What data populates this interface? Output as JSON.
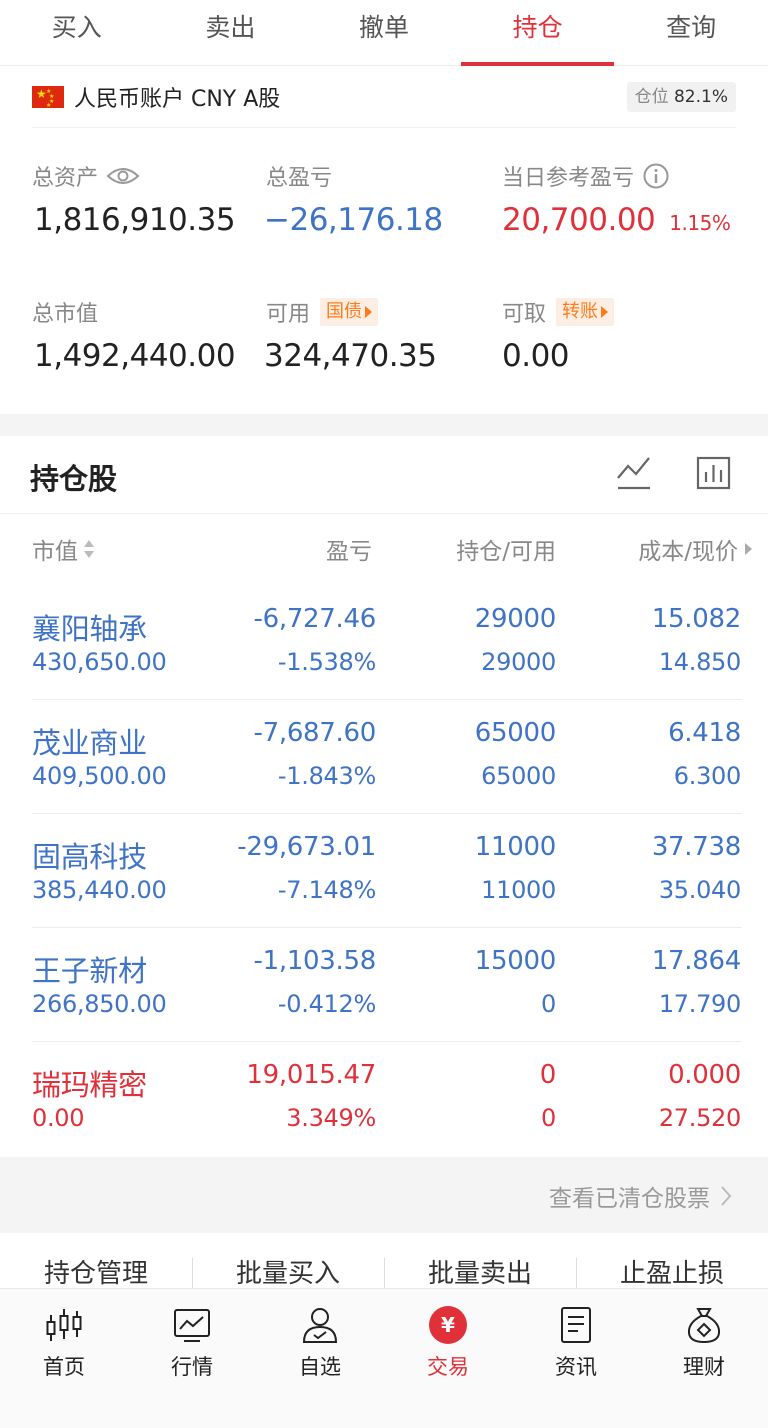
{
  "tabs": [
    "买入",
    "卖出",
    "撤单",
    "持仓",
    "查询"
  ],
  "account": {
    "name": "人民币账户 CNY A股",
    "position_label": "仓位",
    "position_value": "82.1%"
  },
  "summary": {
    "total_assets_label": "总资产",
    "total_assets": "1,816,910.35",
    "total_pnl_label": "总盈亏",
    "total_pnl": "−26,176.18",
    "daily_pnl_label": "当日参考盈亏",
    "daily_pnl": "20,700.00",
    "daily_pnl_pct": "1.15%",
    "market_value_label": "总市值",
    "market_value": "1,492,440.00",
    "available_label": "可用",
    "available_tag": "国债",
    "available": "324,470.35",
    "withdrawable_label": "可取",
    "withdrawable_tag": "转账",
    "withdrawable": "0.00"
  },
  "holdings": {
    "title": "持仓股",
    "headers": {
      "market_value": "市值",
      "pnl": "盈亏",
      "position": "持仓/可用",
      "price": "成本/现价"
    },
    "rows": [
      {
        "name": "襄阳轴承",
        "value": "430,650.00",
        "pnl": "-6,727.46",
        "pnl_pct": "-1.538%",
        "hold": "29000",
        "avail": "29000",
        "cost": "15.082",
        "price": "14.850",
        "color": "#3f73c6"
      },
      {
        "name": "茂业商业",
        "value": "409,500.00",
        "pnl": "-7,687.60",
        "pnl_pct": "-1.843%",
        "hold": "65000",
        "avail": "65000",
        "cost": "6.418",
        "price": "6.300",
        "color": "#3f73c6"
      },
      {
        "name": "固高科技",
        "value": "385,440.00",
        "pnl": "-29,673.01",
        "pnl_pct": "-7.148%",
        "hold": "11000",
        "avail": "11000",
        "cost": "37.738",
        "price": "35.040",
        "color": "#3f73c6"
      },
      {
        "name": "王子新材",
        "value": "266,850.00",
        "pnl": "-1,103.58",
        "pnl_pct": "-0.412%",
        "hold": "15000",
        "avail": "0",
        "cost": "17.864",
        "price": "17.790",
        "color": "#3f73c6"
      },
      {
        "name": "瑞玛精密",
        "value": "0.00",
        "pnl": "19,015.47",
        "pnl_pct": "3.349%",
        "hold": "0",
        "avail": "0",
        "cost": "0.000",
        "price": "27.520",
        "color": "#e0313b"
      }
    ],
    "cleared_link": "查看已清仓股票"
  },
  "quick_actions": [
    "持仓管理",
    "批量买入",
    "批量卖出",
    "止盈止损"
  ],
  "nav": [
    {
      "label": "首页",
      "icon": "candlestick-icon"
    },
    {
      "label": "行情",
      "icon": "chart-monitor-icon"
    },
    {
      "label": "自选",
      "icon": "user-check-icon"
    },
    {
      "label": "交易",
      "icon": "yen-icon"
    },
    {
      "label": "资讯",
      "icon": "document-icon"
    },
    {
      "label": "理财",
      "icon": "money-bag-icon"
    }
  ]
}
